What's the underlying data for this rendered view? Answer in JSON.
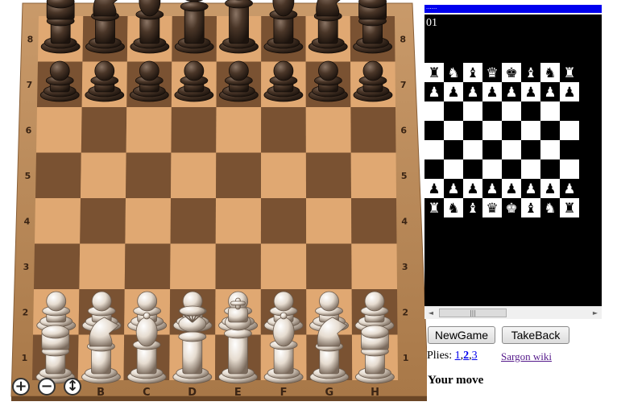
{
  "board": {
    "rank_labels": [
      "8",
      "7",
      "6",
      "5",
      "4",
      "3",
      "2",
      "1"
    ],
    "file_labels": [
      "B",
      "C",
      "D",
      "E",
      "F",
      "G",
      "H"
    ],
    "colors": {
      "light_square": "#e0a872",
      "dark_square": "#7a5232",
      "frame": "#b58556",
      "black_piece": "#3a2a20",
      "white_piece": "#e6dcd0"
    },
    "position": [
      [
        "r",
        "n",
        "b",
        "q",
        "k",
        "b",
        "n",
        "r"
      ],
      [
        "p",
        "p",
        "p",
        "p",
        "p",
        "p",
        "p",
        "p"
      ],
      [
        "",
        "",
        "",
        "",
        "",
        "",
        "",
        ""
      ],
      [
        "",
        "",
        "",
        "",
        "",
        "",
        "",
        ""
      ],
      [
        "",
        "",
        "",
        "",
        "",
        "",
        "",
        ""
      ],
      [
        "",
        "",
        "",
        "",
        "",
        "",
        "",
        ""
      ],
      [
        "P",
        "P",
        "P",
        "P",
        "P",
        "P",
        "P",
        "P"
      ],
      [
        "R",
        "N",
        "B",
        "Q",
        "K",
        "B",
        "N",
        "R"
      ]
    ],
    "zoom_in_icon": "plus-icon",
    "zoom_out_icon": "minus-icon",
    "tilt_icon": "vertical-arrows-icon"
  },
  "zoom": {
    "in": "+",
    "out": "−",
    "tilt": "↕"
  },
  "terminal": {
    "progress_text": "......",
    "counter": "01",
    "rows": [
      [
        "♜",
        "♞",
        "♝",
        "♛",
        "♚",
        "♝",
        "♞",
        "♜"
      ],
      [
        "♟",
        "♟",
        "♟",
        "♟",
        "♟",
        "♟",
        "♟",
        "♟"
      ],
      [
        "",
        "",
        "",
        "",
        "",
        "",
        "",
        ""
      ],
      [
        "",
        "",
        "",
        "",
        "",
        "",
        "",
        ""
      ],
      [
        "",
        "",
        "",
        "",
        "",
        "",
        "",
        ""
      ],
      [
        "",
        "",
        "",
        "",
        "",
        "",
        "",
        ""
      ],
      [
        "♟",
        "♟",
        "♟",
        "♟",
        "♟",
        "♟",
        "♟",
        "♟"
      ],
      [
        "♜",
        "♞",
        "♝",
        "♛",
        "♚",
        "♝",
        "♞",
        "♜"
      ]
    ]
  },
  "scrollbar": {
    "thumb": "|||",
    "left": "◄",
    "right": "►"
  },
  "buttons": {
    "new_game": "NewGame",
    "take_back": "TakeBack"
  },
  "plies": {
    "label": "Plies:",
    "options": [
      "1",
      "2",
      "3"
    ],
    "selected": "2"
  },
  "links": {
    "wiki": "Sargon wiki"
  },
  "status": "Your move"
}
